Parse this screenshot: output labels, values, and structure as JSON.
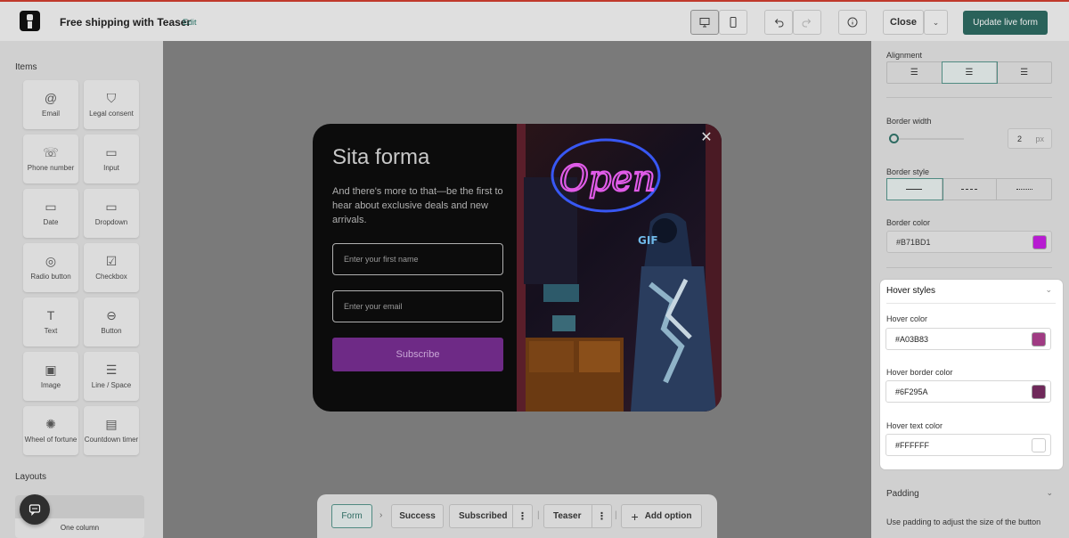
{
  "topbar": {
    "title": "Free shipping with Teaser",
    "edit_label": "Edit",
    "close_label": "Close",
    "update_label": "Update live form",
    "icons": [
      "desktop-icon",
      "mobile-icon",
      "undo-icon",
      "redo-icon",
      "info-icon",
      "chevron-down-icon"
    ]
  },
  "left": {
    "items_heading": "Items",
    "items": [
      {
        "label": "Email",
        "icon": "@"
      },
      {
        "label": "Legal consent",
        "icon": "⛉"
      },
      {
        "label": "Phone number",
        "icon": "☏"
      },
      {
        "label": "Input",
        "icon": "▭"
      },
      {
        "label": "Date",
        "icon": "▭"
      },
      {
        "label": "Dropdown",
        "icon": "▭"
      },
      {
        "label": "Radio button",
        "icon": "◎"
      },
      {
        "label": "Checkbox",
        "icon": "☑"
      },
      {
        "label": "Text",
        "icon": "T"
      },
      {
        "label": "Button",
        "icon": "⊖"
      },
      {
        "label": "Image",
        "icon": "▣"
      },
      {
        "label": "Line / Space",
        "icon": "☰"
      },
      {
        "label": "Wheel of fortune",
        "icon": "✺"
      },
      {
        "label": "Countdown timer",
        "icon": "▤"
      }
    ],
    "layouts_heading": "Layouts",
    "layout_card_label": "One column"
  },
  "popup": {
    "title": "Sita forma",
    "description": "And there's more to that—be the first to hear about exclusive deals and new arrivals.",
    "first_name_placeholder": "Enter your first name",
    "email_placeholder": "Enter your email",
    "subscribe_label": "Subscribe",
    "neon_sign": "Open"
  },
  "steps": {
    "form": "Form",
    "success": "Success",
    "subscribed": "Subscribed",
    "teaser": "Teaser",
    "add_option": "Add option"
  },
  "right": {
    "alignment_label": "Alignment",
    "border_width_label": "Border width",
    "border_width_value": "2",
    "border_width_unit": "px",
    "border_width_fraction": 0.0,
    "border_style_label": "Border style",
    "border_color_label": "Border color",
    "border_color": "#B71BD1",
    "hover": {
      "title": "Hover styles",
      "hover_color_label": "Hover color",
      "hover_color": "#A03B83",
      "hover_border_color_label": "Hover border color",
      "hover_border_color": "#6F295A",
      "hover_text_color_label": "Hover text color",
      "hover_text_color": "#FFFFFF"
    },
    "padding_label": "Padding",
    "padding_help": "Use padding to adjust the size of the button"
  }
}
